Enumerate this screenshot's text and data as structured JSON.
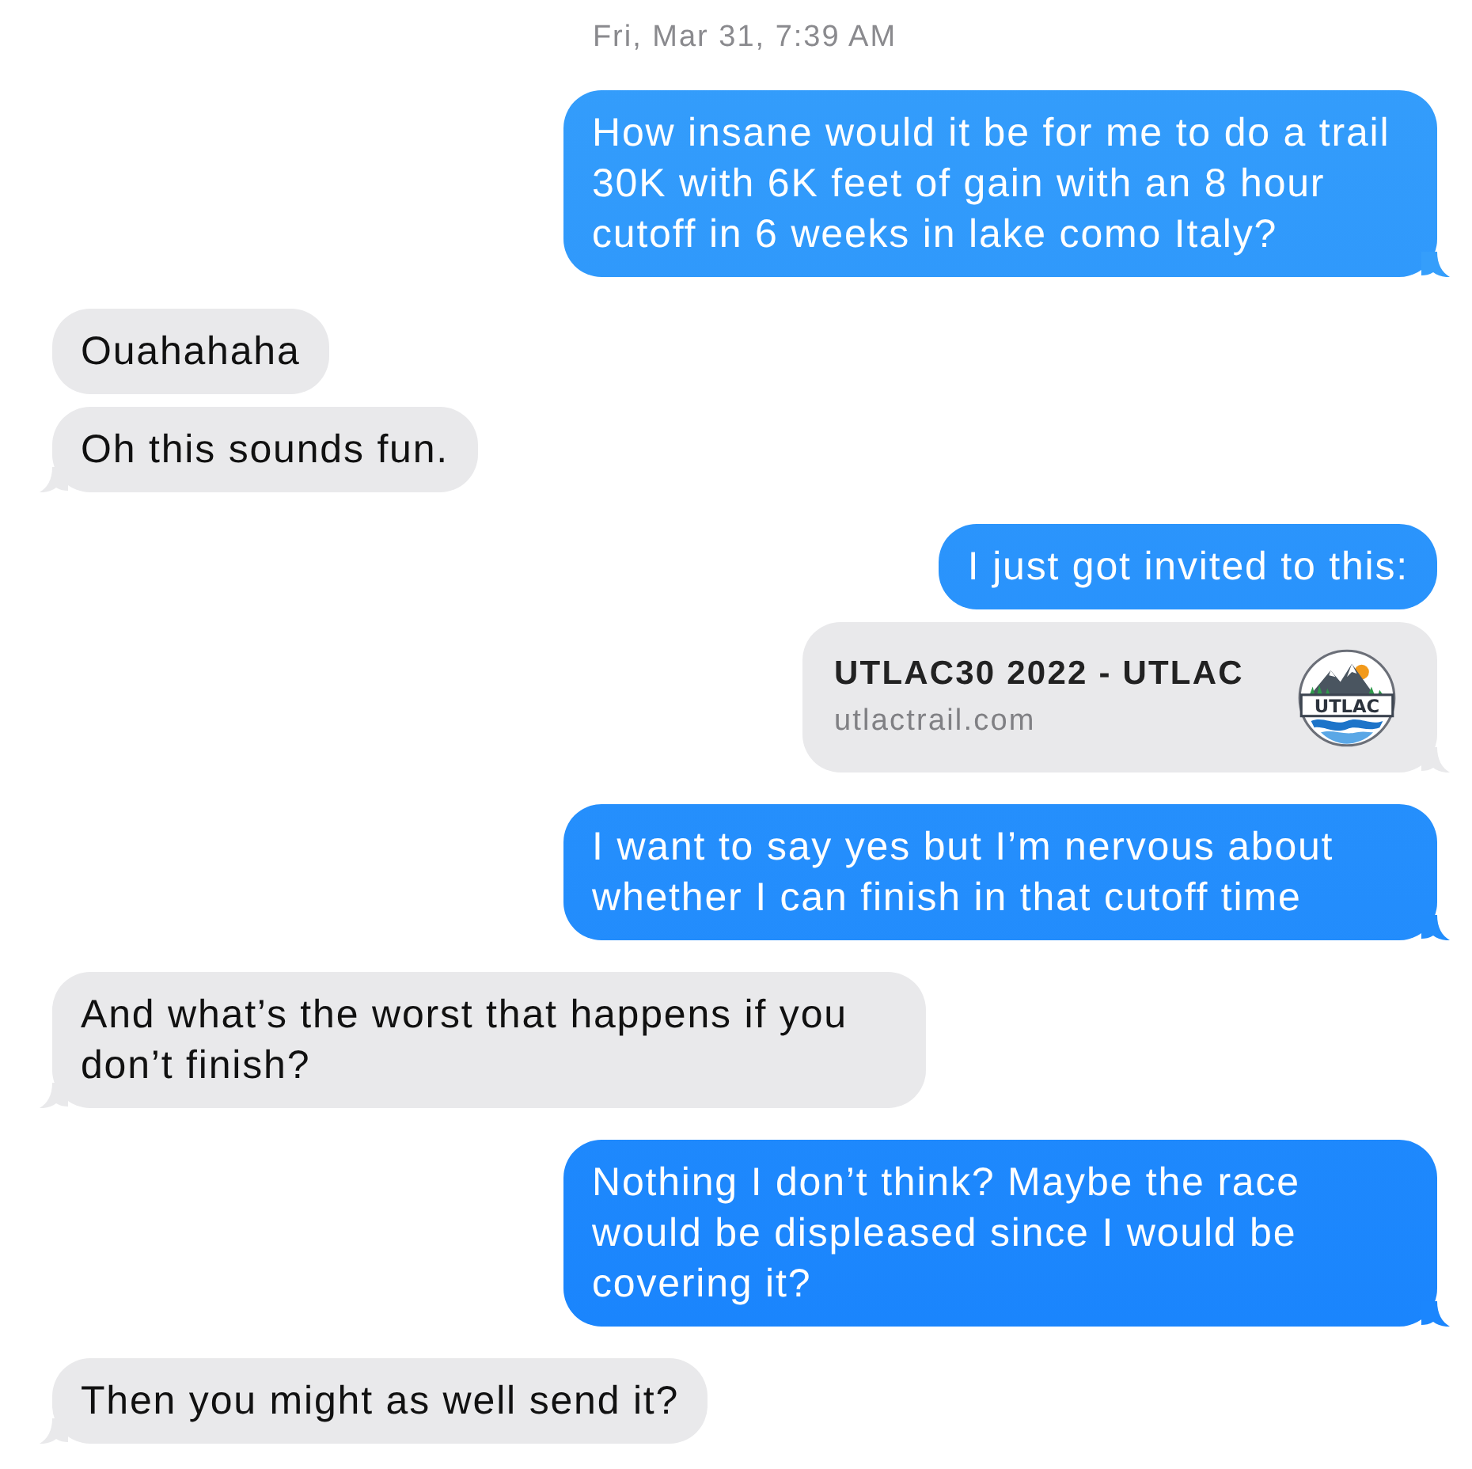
{
  "timestamp": "Fri, Mar 31, 7:39 AM",
  "messages": [
    {
      "kind": "sent",
      "text": "How insane would it be for me to do a trail 30K with 6K feet of gain with an 8 hour cutoff in 6 weeks in lake como Italy?",
      "tail": true
    },
    {
      "kind": "received",
      "text": "Ouahahaha",
      "tail": false
    },
    {
      "kind": "received",
      "text": "Oh this sounds fun.",
      "tail": true
    },
    {
      "kind": "sent",
      "text": "I just got invited to this:",
      "tail": false
    },
    {
      "kind": "link",
      "title": "UTLAC30 2022 - UTLAC",
      "domain": "utlactrail.com",
      "logo_text": "UTLAC",
      "tail": true
    },
    {
      "kind": "sent",
      "text": "I want to say yes but I’m nervous about whether I can finish in that cutoff time",
      "tail": true
    },
    {
      "kind": "received",
      "text": "And what’s the worst that happens if you don’t finish?",
      "tail": true
    },
    {
      "kind": "sent",
      "text": "Nothing I don’t think? Maybe the race would be displeased since I would be covering it?",
      "tail": true
    },
    {
      "kind": "received",
      "text": "Then you might as well send it?",
      "tail": true
    }
  ]
}
